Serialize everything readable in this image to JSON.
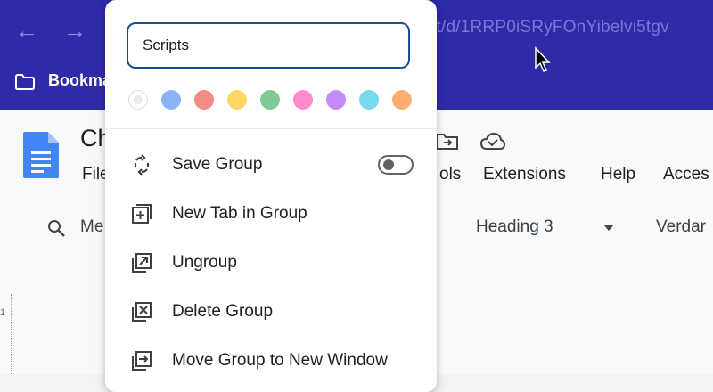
{
  "browser": {
    "url_fragment": "ent/d/1RRP0iSRyFOnYibelvi5tgv",
    "bookmarks_label": "Bookma"
  },
  "docs": {
    "title_fragment": "Ch",
    "menus": {
      "file": "File",
      "tools_fragment": "ols",
      "extensions": "Extensions",
      "help": "Help",
      "accessibility_fragment": "Acces"
    },
    "toolbar": {
      "menus_fragment": "Me",
      "style_value": "Heading 3",
      "font_fragment": "Verdar"
    },
    "ruler_tick": "1"
  },
  "tab_group_popup": {
    "name_value": "Scripts",
    "colors": [
      "#e8eaed",
      "#8ab4f8",
      "#f28b82",
      "#fdd663",
      "#81c995",
      "#ff8bcb",
      "#c58af9",
      "#78d9ec",
      "#fcad70"
    ],
    "selected_color_index": 0,
    "items": [
      {
        "label": "Save Group",
        "icon": "sync-icon"
      },
      {
        "label": "New Tab in Group",
        "icon": "add-tab-icon"
      },
      {
        "label": "Ungroup",
        "icon": "ungroup-icon"
      },
      {
        "label": "Delete Group",
        "icon": "delete-group-icon"
      },
      {
        "label": "Move Group to New Window",
        "icon": "move-to-window-icon"
      }
    ],
    "save_group_toggle_on": false
  },
  "colors": {
    "chrome_bg": "#2f2aa8",
    "input_border": "#1a4f8f",
    "docs_blue": "#4285f4"
  }
}
